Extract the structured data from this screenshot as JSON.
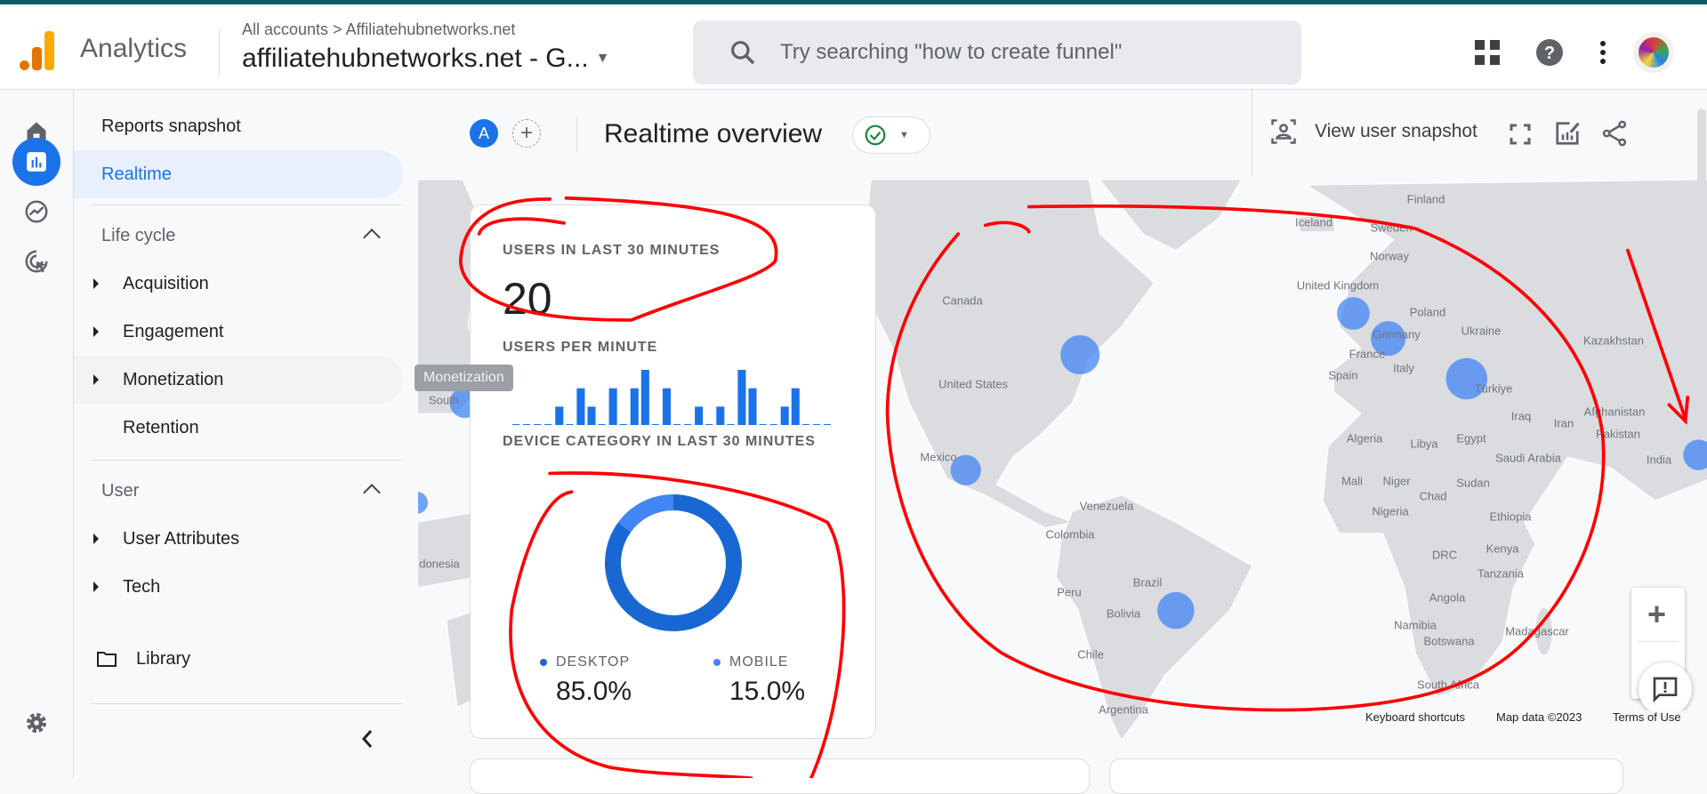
{
  "header": {
    "app_name": "Analytics",
    "breadcrumb": "All accounts > Affiliatehubnetworks.net",
    "property": "affiliatehubnetworks.net - G...",
    "search_placeholder": "Try searching \"how to create funnel\""
  },
  "nav": {
    "reports_snapshot": "Reports snapshot",
    "realtime": "Realtime",
    "lifecycle": "Life cycle",
    "acquisition": "Acquisition",
    "engagement": "Engagement",
    "monetization": "Monetization",
    "retention": "Retention",
    "user": "User",
    "user_attributes": "User Attributes",
    "tech": "Tech",
    "library": "Library"
  },
  "toolbar": {
    "comparison_avatar": "A",
    "title": "Realtime overview",
    "view_user_snapshot": "View user snapshot"
  },
  "tooltip": "Monetization",
  "card": {
    "users_title": "USERS IN LAST 30 MINUTES",
    "users_value": "20",
    "per_minute_title": "USERS PER MINUTE",
    "device_title": "DEVICE CATEGORY IN LAST 30 MINUTES",
    "desktop_label": "DESKTOP",
    "desktop_value": "85.0%",
    "mobile_label": "MOBILE",
    "mobile_value": "15.0%"
  },
  "chart_data": [
    {
      "type": "bar",
      "title": "USERS PER MINUTE",
      "values": [
        0,
        0,
        0,
        0,
        1,
        0,
        2,
        1,
        0,
        2,
        0,
        2,
        3,
        0,
        2,
        0,
        0,
        1,
        0,
        1,
        0,
        3,
        2,
        0,
        0,
        1,
        2,
        0,
        0,
        0
      ],
      "color": "#1a73e8"
    },
    {
      "type": "pie",
      "title": "DEVICE CATEGORY IN LAST 30 MINUTES",
      "categories": [
        "DESKTOP",
        "MOBILE"
      ],
      "values": [
        85.0,
        15.0
      ],
      "colors": [
        "#1967d2",
        "#4285f4"
      ]
    }
  ],
  "map": {
    "labels": [
      "Finland",
      "Sweden",
      "Iceland",
      "Norway",
      "United Kingdom",
      "Poland",
      "Germany",
      "Ukraine",
      "Kazakhstan",
      "France",
      "Italy",
      "Spain",
      "Türkiye",
      "Canada",
      "United States",
      "Mexico",
      "Iraq",
      "Iran",
      "Afghanistan",
      "Pakistan",
      "India",
      "Algeria",
      "Libya",
      "Egypt",
      "Saudi Arabia",
      "Mali",
      "Niger",
      "Chad",
      "Sudan",
      "Nigeria",
      "Ethiopia",
      "Venezuela",
      "Colombia",
      "Kenya",
      "DRC",
      "Tanzania",
      "Brazil",
      "Peru",
      "Bolivia",
      "Angola",
      "Namibia",
      "Botswana",
      "Madagascar",
      "Chile",
      "South Africa",
      "Argentina",
      "South",
      "donesia"
    ],
    "keyboard_shortcuts": "Keyboard shortcuts",
    "map_data": "Map data ©2023",
    "terms": "Terms of Use"
  },
  "colors": {
    "accent": "#1a73e8",
    "bubble": "#4285f4",
    "annotation": "#ff0000"
  }
}
